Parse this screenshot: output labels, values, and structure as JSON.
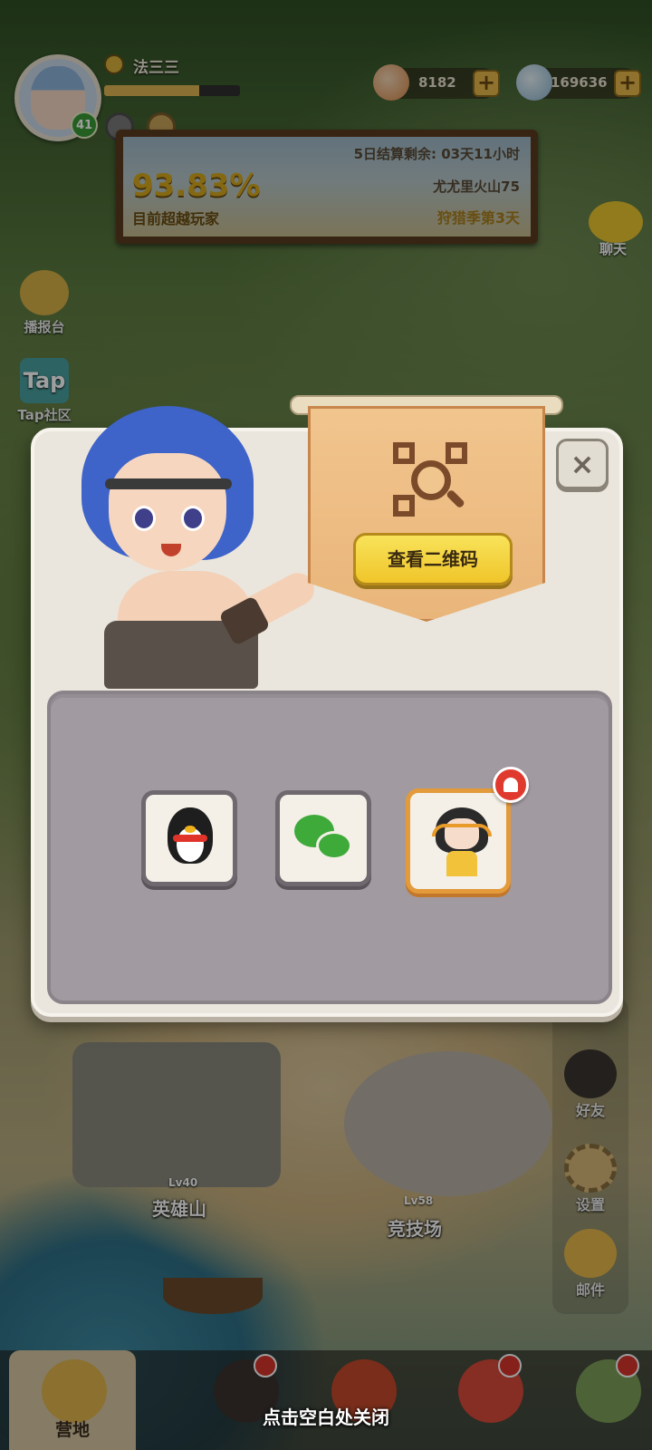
{
  "player": {
    "name": "法三三",
    "level": "41",
    "xp_fraction": 0.7
  },
  "currencies": [
    {
      "icon": "meat-icon",
      "value": "8182"
    },
    {
      "icon": "stone-shell-icon",
      "value": "169636"
    }
  ],
  "season": {
    "remaining": "5日结算剩余: 03天11小时",
    "percent": "93.83%",
    "beat_label": "目前超越玩家",
    "region": "尤尤里火山75",
    "hunt": "狩猎季第3天"
  },
  "left_menu": [
    {
      "label": "播报台",
      "icon": "bird-icon"
    },
    {
      "label": "Tap社区",
      "icon": "tap-logo"
    }
  ],
  "chat": {
    "label": "聊天"
  },
  "right_menu": [
    {
      "label": "好友",
      "icon": "friends-icon"
    },
    {
      "label": "设置",
      "icon": "gear-icon"
    },
    {
      "label": "邮件",
      "icon": "mail-icon"
    }
  ],
  "map": {
    "hero_mountain": "英雄山",
    "hero_lv": "Lv40",
    "arena": "竞技场",
    "arena_lv": "Lv58"
  },
  "dialog": {
    "qr_button": "查看二维码",
    "share": [
      {
        "name": "QQ",
        "icon": "qq-penguin-icon"
      },
      {
        "name": "WeChat",
        "icon": "wechat-icon"
      },
      {
        "name": "Support",
        "icon": "support-girl-icon"
      }
    ]
  },
  "bottom_nav": [
    {
      "label": "营地"
    },
    {
      "label": ""
    },
    {
      "label": ""
    },
    {
      "label": ""
    },
    {
      "label": ""
    }
  ],
  "close_hint": "点击空白处关闭",
  "colors": {
    "accent_yellow": "#f0c52a",
    "dialog_bg": "#eae6dd",
    "panel_bg": "#a29aa1",
    "alert_red": "#e03a2e"
  }
}
